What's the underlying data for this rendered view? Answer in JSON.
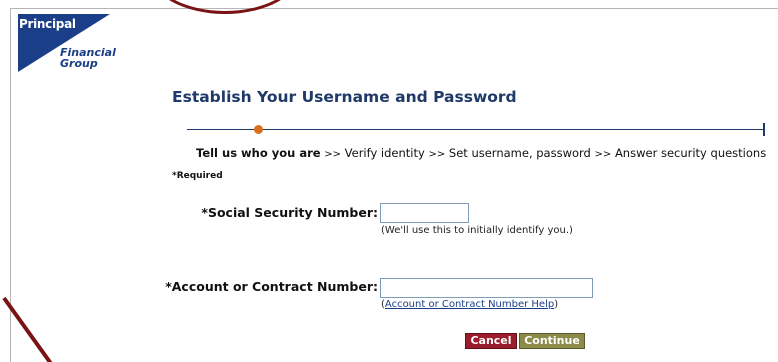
{
  "brand": {
    "name": "Principal",
    "tagline_line1": "Financial",
    "tagline_line2": "Group",
    "brand_color": "#1a3e88"
  },
  "page": {
    "title": "Establish Your Username and Password"
  },
  "progress": {
    "current_step": "Tell us who you are",
    "separator": ">>",
    "steps": [
      "Tell us who you are",
      "Verify identity",
      "Set username, password",
      "Answer security questions"
    ],
    "current_index": 0,
    "dot_color": "#d9711c"
  },
  "form": {
    "required_note": "*Required",
    "ssn": {
      "label": "*Social Security Number:",
      "value": "",
      "help": "(We'll use this to initially identify you.)"
    },
    "account": {
      "label": "*Account or Contract Number:",
      "value": "",
      "help_prefix": "(",
      "help_link": "Account or Contract Number Help",
      "help_suffix": ")"
    }
  },
  "actions": {
    "cancel_label": "Cancel",
    "continue_label": "Continue",
    "cancel_color": "#9b1c2c",
    "continue_color": "#8c8b4a"
  }
}
